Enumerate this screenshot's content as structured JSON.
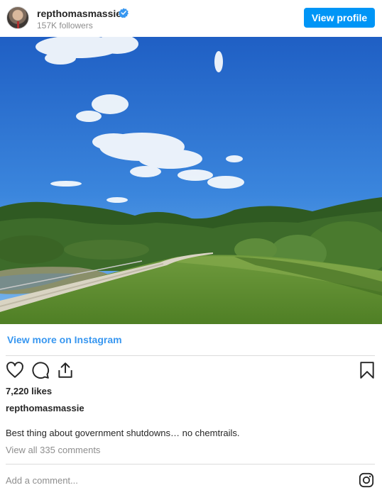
{
  "header": {
    "username": "repthomasmassie",
    "followers": "157K followers",
    "view_profile_label": "View profile"
  },
  "post": {
    "view_more_label": "View more on Instagram",
    "likes": "7,220 likes",
    "owner": "repthomasmassie",
    "caption": "Best thing about government shutdowns… no chemtrails.",
    "view_comments": "View all 335 comments",
    "comment_placeholder": "Add a comment..."
  },
  "icons": {
    "like": "heart-icon",
    "comment": "comment-icon",
    "share": "share-icon",
    "save": "bookmark-icon",
    "instagram": "instagram-icon",
    "verified": "verified-badge-icon"
  },
  "colors": {
    "accent": "#0095f6",
    "link": "#3897f0",
    "muted": "#8e8e8e",
    "text": "#262626"
  }
}
